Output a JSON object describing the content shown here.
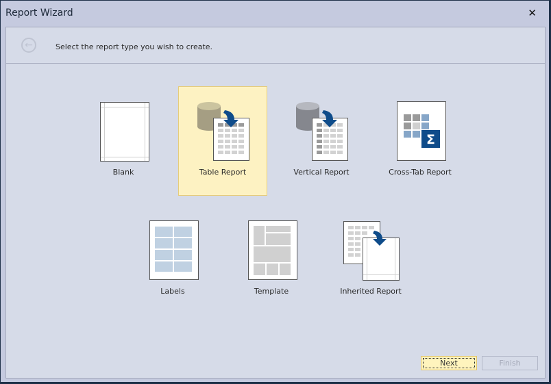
{
  "window": {
    "title": "Report Wizard",
    "close_icon": "close-icon"
  },
  "header": {
    "back_icon": "back-arrow-icon",
    "back_glyph": "←",
    "subtitle": "Select the report type you wish to create."
  },
  "report_types": [
    {
      "label": "Blank",
      "icon": "blank-page-icon",
      "selected": false
    },
    {
      "label": "Table Report",
      "icon": "table-report-icon",
      "selected": true
    },
    {
      "label": "Vertical Report",
      "icon": "vertical-report-icon",
      "selected": false
    },
    {
      "label": "Cross-Tab Report",
      "icon": "cross-tab-icon",
      "selected": false
    },
    {
      "label": "Labels",
      "icon": "labels-icon",
      "selected": false
    },
    {
      "label": "Template",
      "icon": "template-icon",
      "selected": false
    },
    {
      "label": "Inherited Report",
      "icon": "inherited-report-icon",
      "selected": false
    }
  ],
  "buttons": {
    "next": "Next",
    "finish": "Finish",
    "finish_enabled": false
  },
  "colors": {
    "selected_bg": "#fdf2c2",
    "selected_border": "#e6cc7a",
    "accent_blue": "#0f4c8a",
    "panel_bg": "#d6dbe8",
    "window_bg": "#c5cadf"
  }
}
